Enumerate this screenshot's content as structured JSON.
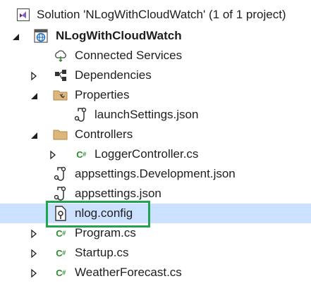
{
  "solution_explorer": {
    "solution_label": "Solution 'NLogWithCloudWatch' (1 of 1 project)",
    "project_label": "NLogWithCloudWatch",
    "items": {
      "connected_services": "Connected Services",
      "dependencies": "Dependencies",
      "properties": "Properties",
      "launch_settings": "launchSettings.json",
      "controllers": "Controllers",
      "logger_controller": "LoggerController.cs",
      "appsettings_development": "appsettings.Development.json",
      "appsettings": "appsettings.json",
      "nlog_config": "nlog.config",
      "program": "Program.cs",
      "startup": "Startup.cs",
      "weather_forecast": "WeatherForecast.cs"
    },
    "selected_item": "nlog.config",
    "colors": {
      "selection": "#cce0ff",
      "highlight_border": "#21a352",
      "cs_icon": "#2e8b2e",
      "folder": "#dcb67a"
    }
  }
}
